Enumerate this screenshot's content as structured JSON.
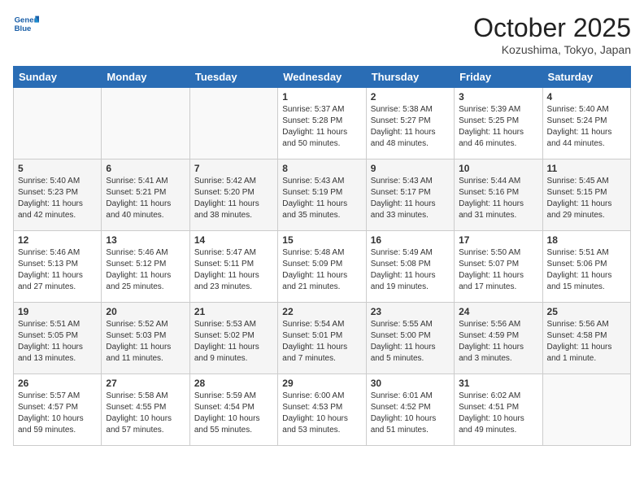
{
  "header": {
    "logo_line1": "General",
    "logo_line2": "Blue",
    "month": "October 2025",
    "location": "Kozushima, Tokyo, Japan"
  },
  "days_of_week": [
    "Sunday",
    "Monday",
    "Tuesday",
    "Wednesday",
    "Thursday",
    "Friday",
    "Saturday"
  ],
  "weeks": [
    [
      {
        "day": "",
        "info": ""
      },
      {
        "day": "",
        "info": ""
      },
      {
        "day": "",
        "info": ""
      },
      {
        "day": "1",
        "info": "Sunrise: 5:37 AM\nSunset: 5:28 PM\nDaylight: 11 hours\nand 50 minutes."
      },
      {
        "day": "2",
        "info": "Sunrise: 5:38 AM\nSunset: 5:27 PM\nDaylight: 11 hours\nand 48 minutes."
      },
      {
        "day": "3",
        "info": "Sunrise: 5:39 AM\nSunset: 5:25 PM\nDaylight: 11 hours\nand 46 minutes."
      },
      {
        "day": "4",
        "info": "Sunrise: 5:40 AM\nSunset: 5:24 PM\nDaylight: 11 hours\nand 44 minutes."
      }
    ],
    [
      {
        "day": "5",
        "info": "Sunrise: 5:40 AM\nSunset: 5:23 PM\nDaylight: 11 hours\nand 42 minutes."
      },
      {
        "day": "6",
        "info": "Sunrise: 5:41 AM\nSunset: 5:21 PM\nDaylight: 11 hours\nand 40 minutes."
      },
      {
        "day": "7",
        "info": "Sunrise: 5:42 AM\nSunset: 5:20 PM\nDaylight: 11 hours\nand 38 minutes."
      },
      {
        "day": "8",
        "info": "Sunrise: 5:43 AM\nSunset: 5:19 PM\nDaylight: 11 hours\nand 35 minutes."
      },
      {
        "day": "9",
        "info": "Sunrise: 5:43 AM\nSunset: 5:17 PM\nDaylight: 11 hours\nand 33 minutes."
      },
      {
        "day": "10",
        "info": "Sunrise: 5:44 AM\nSunset: 5:16 PM\nDaylight: 11 hours\nand 31 minutes."
      },
      {
        "day": "11",
        "info": "Sunrise: 5:45 AM\nSunset: 5:15 PM\nDaylight: 11 hours\nand 29 minutes."
      }
    ],
    [
      {
        "day": "12",
        "info": "Sunrise: 5:46 AM\nSunset: 5:13 PM\nDaylight: 11 hours\nand 27 minutes."
      },
      {
        "day": "13",
        "info": "Sunrise: 5:46 AM\nSunset: 5:12 PM\nDaylight: 11 hours\nand 25 minutes."
      },
      {
        "day": "14",
        "info": "Sunrise: 5:47 AM\nSunset: 5:11 PM\nDaylight: 11 hours\nand 23 minutes."
      },
      {
        "day": "15",
        "info": "Sunrise: 5:48 AM\nSunset: 5:09 PM\nDaylight: 11 hours\nand 21 minutes."
      },
      {
        "day": "16",
        "info": "Sunrise: 5:49 AM\nSunset: 5:08 PM\nDaylight: 11 hours\nand 19 minutes."
      },
      {
        "day": "17",
        "info": "Sunrise: 5:50 AM\nSunset: 5:07 PM\nDaylight: 11 hours\nand 17 minutes."
      },
      {
        "day": "18",
        "info": "Sunrise: 5:51 AM\nSunset: 5:06 PM\nDaylight: 11 hours\nand 15 minutes."
      }
    ],
    [
      {
        "day": "19",
        "info": "Sunrise: 5:51 AM\nSunset: 5:05 PM\nDaylight: 11 hours\nand 13 minutes."
      },
      {
        "day": "20",
        "info": "Sunrise: 5:52 AM\nSunset: 5:03 PM\nDaylight: 11 hours\nand 11 minutes."
      },
      {
        "day": "21",
        "info": "Sunrise: 5:53 AM\nSunset: 5:02 PM\nDaylight: 11 hours\nand 9 minutes."
      },
      {
        "day": "22",
        "info": "Sunrise: 5:54 AM\nSunset: 5:01 PM\nDaylight: 11 hours\nand 7 minutes."
      },
      {
        "day": "23",
        "info": "Sunrise: 5:55 AM\nSunset: 5:00 PM\nDaylight: 11 hours\nand 5 minutes."
      },
      {
        "day": "24",
        "info": "Sunrise: 5:56 AM\nSunset: 4:59 PM\nDaylight: 11 hours\nand 3 minutes."
      },
      {
        "day": "25",
        "info": "Sunrise: 5:56 AM\nSunset: 4:58 PM\nDaylight: 11 hours\nand 1 minute."
      }
    ],
    [
      {
        "day": "26",
        "info": "Sunrise: 5:57 AM\nSunset: 4:57 PM\nDaylight: 10 hours\nand 59 minutes."
      },
      {
        "day": "27",
        "info": "Sunrise: 5:58 AM\nSunset: 4:55 PM\nDaylight: 10 hours\nand 57 minutes."
      },
      {
        "day": "28",
        "info": "Sunrise: 5:59 AM\nSunset: 4:54 PM\nDaylight: 10 hours\nand 55 minutes."
      },
      {
        "day": "29",
        "info": "Sunrise: 6:00 AM\nSunset: 4:53 PM\nDaylight: 10 hours\nand 53 minutes."
      },
      {
        "day": "30",
        "info": "Sunrise: 6:01 AM\nSunset: 4:52 PM\nDaylight: 10 hours\nand 51 minutes."
      },
      {
        "day": "31",
        "info": "Sunrise: 6:02 AM\nSunset: 4:51 PM\nDaylight: 10 hours\nand 49 minutes."
      },
      {
        "day": "",
        "info": ""
      }
    ]
  ]
}
